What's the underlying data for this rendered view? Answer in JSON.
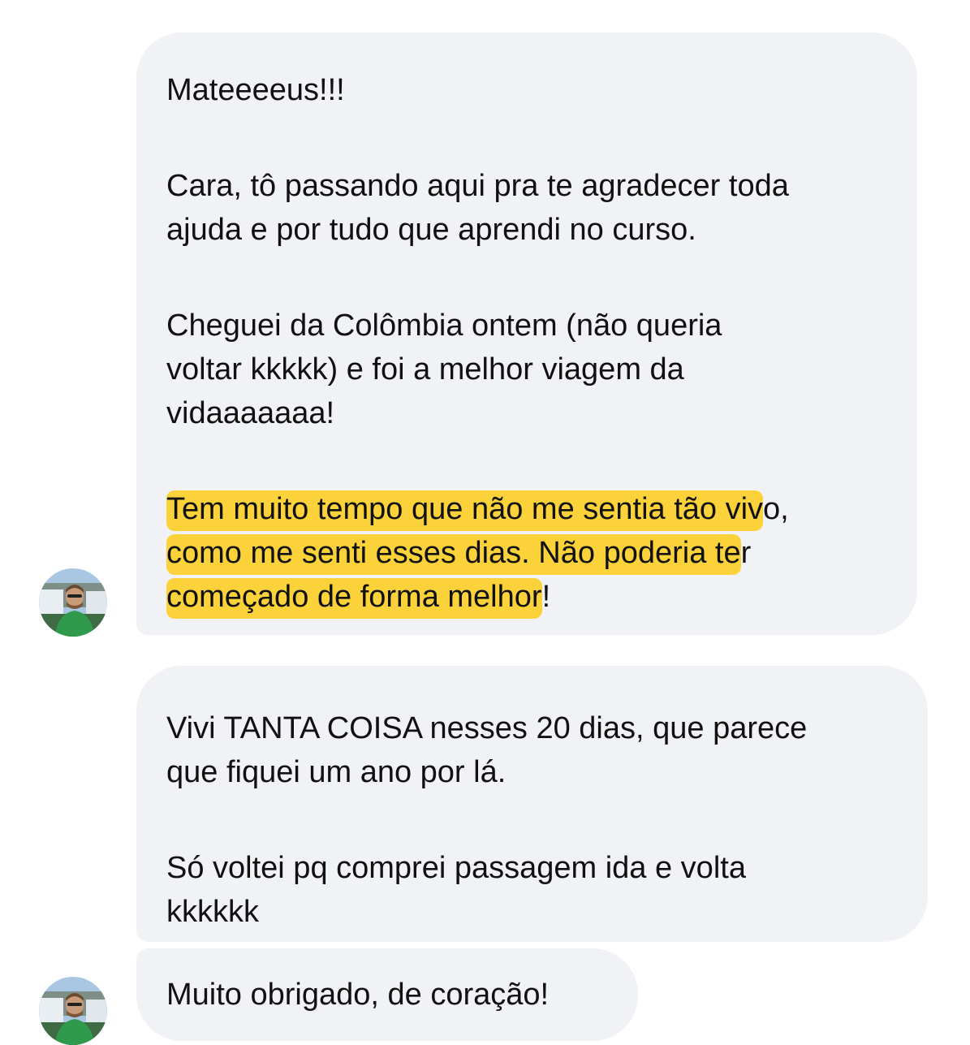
{
  "messages": [
    {
      "paragraphs": [
        "Mateeeeus!!!",
        "Cara, tô passando aqui pra te agradecer toda\najuda e por tudo que aprendi no curso.",
        "Cheguei da Colômbia ontem (não queria\nvoltar kkkkk) e foi a melhor viagem da\nvidaaaaaaa!"
      ],
      "highlight": {
        "line1_marked": "Tem muito tempo que não me sentia tão viv",
        "line1_rest": "o,",
        "line2_marked": "como me senti esses dias. Não poderia te",
        "line2_rest": "r",
        "line3_marked": "começado de forma melhor",
        "line3_rest": "!"
      }
    },
    {
      "paragraphs": [
        "Vivi TANTA COISA nesses 20 dias, que parece\nque fiquei um ano por lá.",
        "Só voltei pq comprei passagem ida e volta\nkkkkkk"
      ]
    },
    {
      "paragraphs": [
        "Muito obrigado, de coração!"
      ]
    }
  ],
  "colors": {
    "bubble": "#f0f2f5",
    "highlight": "#fcd23a",
    "text": "#111111"
  },
  "icons": {
    "avatar": "sender-avatar-photo"
  }
}
